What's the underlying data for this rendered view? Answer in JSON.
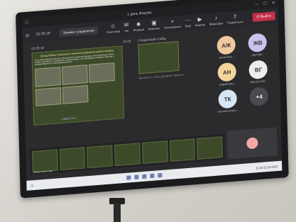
{
  "window": {
    "title": "1 день Форуму"
  },
  "toolbar": {
    "timer": "02:35:18",
    "manage_label": "Элемент управления",
    "items": [
      {
        "label": "Участники",
        "icon": "people-icon"
      },
      {
        "label": "Чат",
        "icon": "chat-icon"
      },
      {
        "label": "Реакции",
        "icon": "reaction-icon"
      },
      {
        "label": "Комнаты",
        "icon": "rooms-icon"
      },
      {
        "label": "Приложения",
        "icon": "apps-icon"
      },
      {
        "label": "Еще",
        "icon": "more-icon"
      },
      {
        "label": "Камера",
        "icon": "camera-icon"
      },
      {
        "label": "Микрофон",
        "icon": "mic-icon"
      },
      {
        "label": "Поделиться",
        "icon": "share-icon"
      }
    ],
    "leave_label": "Выйти"
  },
  "stage": {
    "header_left": "02:35:18",
    "header_right": "14:18",
    "slide_title": "Вклад бойцов Уральского танкового добровольческого корпуса",
    "slide_text": "В составе добровольческого корпуса были танковые бригады, мотострелковые части. Корпус участвовал в сражениях на Курской дуге, в освобождении Украины, Польши, в штурме Берлина и освобождении Праги.",
    "slide_nav": "Слайд 2 из 6",
    "next_label": "Следующий слайд",
    "notes": "Щелкните, чтобы добавить заметки"
  },
  "participants": [
    {
      "initials": "АЖ",
      "name": "Антон Жил...",
      "color": "#f0c8a0"
    },
    {
      "initials": "ЖВ",
      "name": "Жил Вен...",
      "color": "#c9c3ee"
    },
    {
      "initials": "АН",
      "name": "Андрей Нал...",
      "color": "#f3d59b"
    },
    {
      "initials": "ВГ",
      "name": "Виктор Глеб...",
      "color": "#ececec"
    },
    {
      "initials": "ТК",
      "name": "Татьяна Колесо...",
      "color": "#d7e6f5"
    },
    {
      "initials": "+4",
      "name": "",
      "color": "#4a4a50"
    }
  ],
  "strip": {
    "caption": "Элена Колесова"
  },
  "taskbar": {
    "time": "11:23",
    "date": "23.10.2023"
  }
}
